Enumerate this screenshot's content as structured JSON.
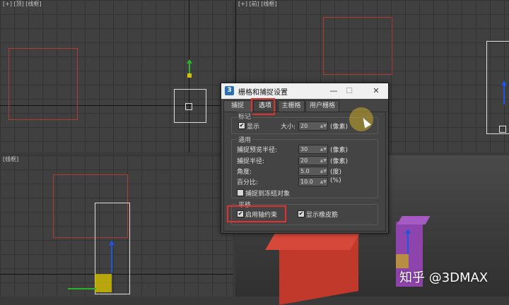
{
  "viewports": {
    "top_left": {
      "label": "[+] [顶] [线框]"
    },
    "top_right": {
      "label": "[+] [前] [线框]"
    },
    "bottom_left": {
      "label": "[线框]"
    }
  },
  "dialog": {
    "icon": "3",
    "title": "栅格和捕捉设置",
    "minimize": "—",
    "maximize": "☐",
    "close": "✕",
    "tabs": [
      "捕捉",
      "选项",
      "主栅格",
      "用户栅格"
    ],
    "active_tab": "选项",
    "markers": {
      "title": "标记",
      "display_label": "显示",
      "display_checked": true,
      "size_label": "大小:",
      "size_value": "20",
      "size_unit": "(像素)"
    },
    "general": {
      "title": "通用",
      "snap_preview_label": "捕捉预览半径:",
      "snap_preview_value": "30",
      "snap_preview_unit": "(像素)",
      "snap_radius_label": "捕捉半径:",
      "snap_radius_value": "20",
      "snap_radius_unit": "(像素)",
      "angle_label": "角度:",
      "angle_value": "5.0",
      "angle_unit": "(度)",
      "percent_label": "百分比:",
      "percent_value": "10.0",
      "percent_unit": "(%)",
      "snap_frozen_label": "捕捉到冻结对象",
      "snap_frozen_checked": false
    },
    "translation": {
      "title": "平移",
      "axis_constraint_label": "启用轴约束",
      "axis_constraint_checked": true,
      "rubber_band_label": "显示橡皮筋",
      "rubber_band_checked": true
    }
  },
  "icons": {
    "spinner": "spinner-arrows-icon",
    "check": "checkmark-icon",
    "cursor": "mouse-cursor-icon"
  },
  "colors": {
    "highlight_box": "#e0312f",
    "object_red": "#c0392b",
    "object_purple": "#8e44ad"
  },
  "watermark": "知乎 @3DMAX"
}
